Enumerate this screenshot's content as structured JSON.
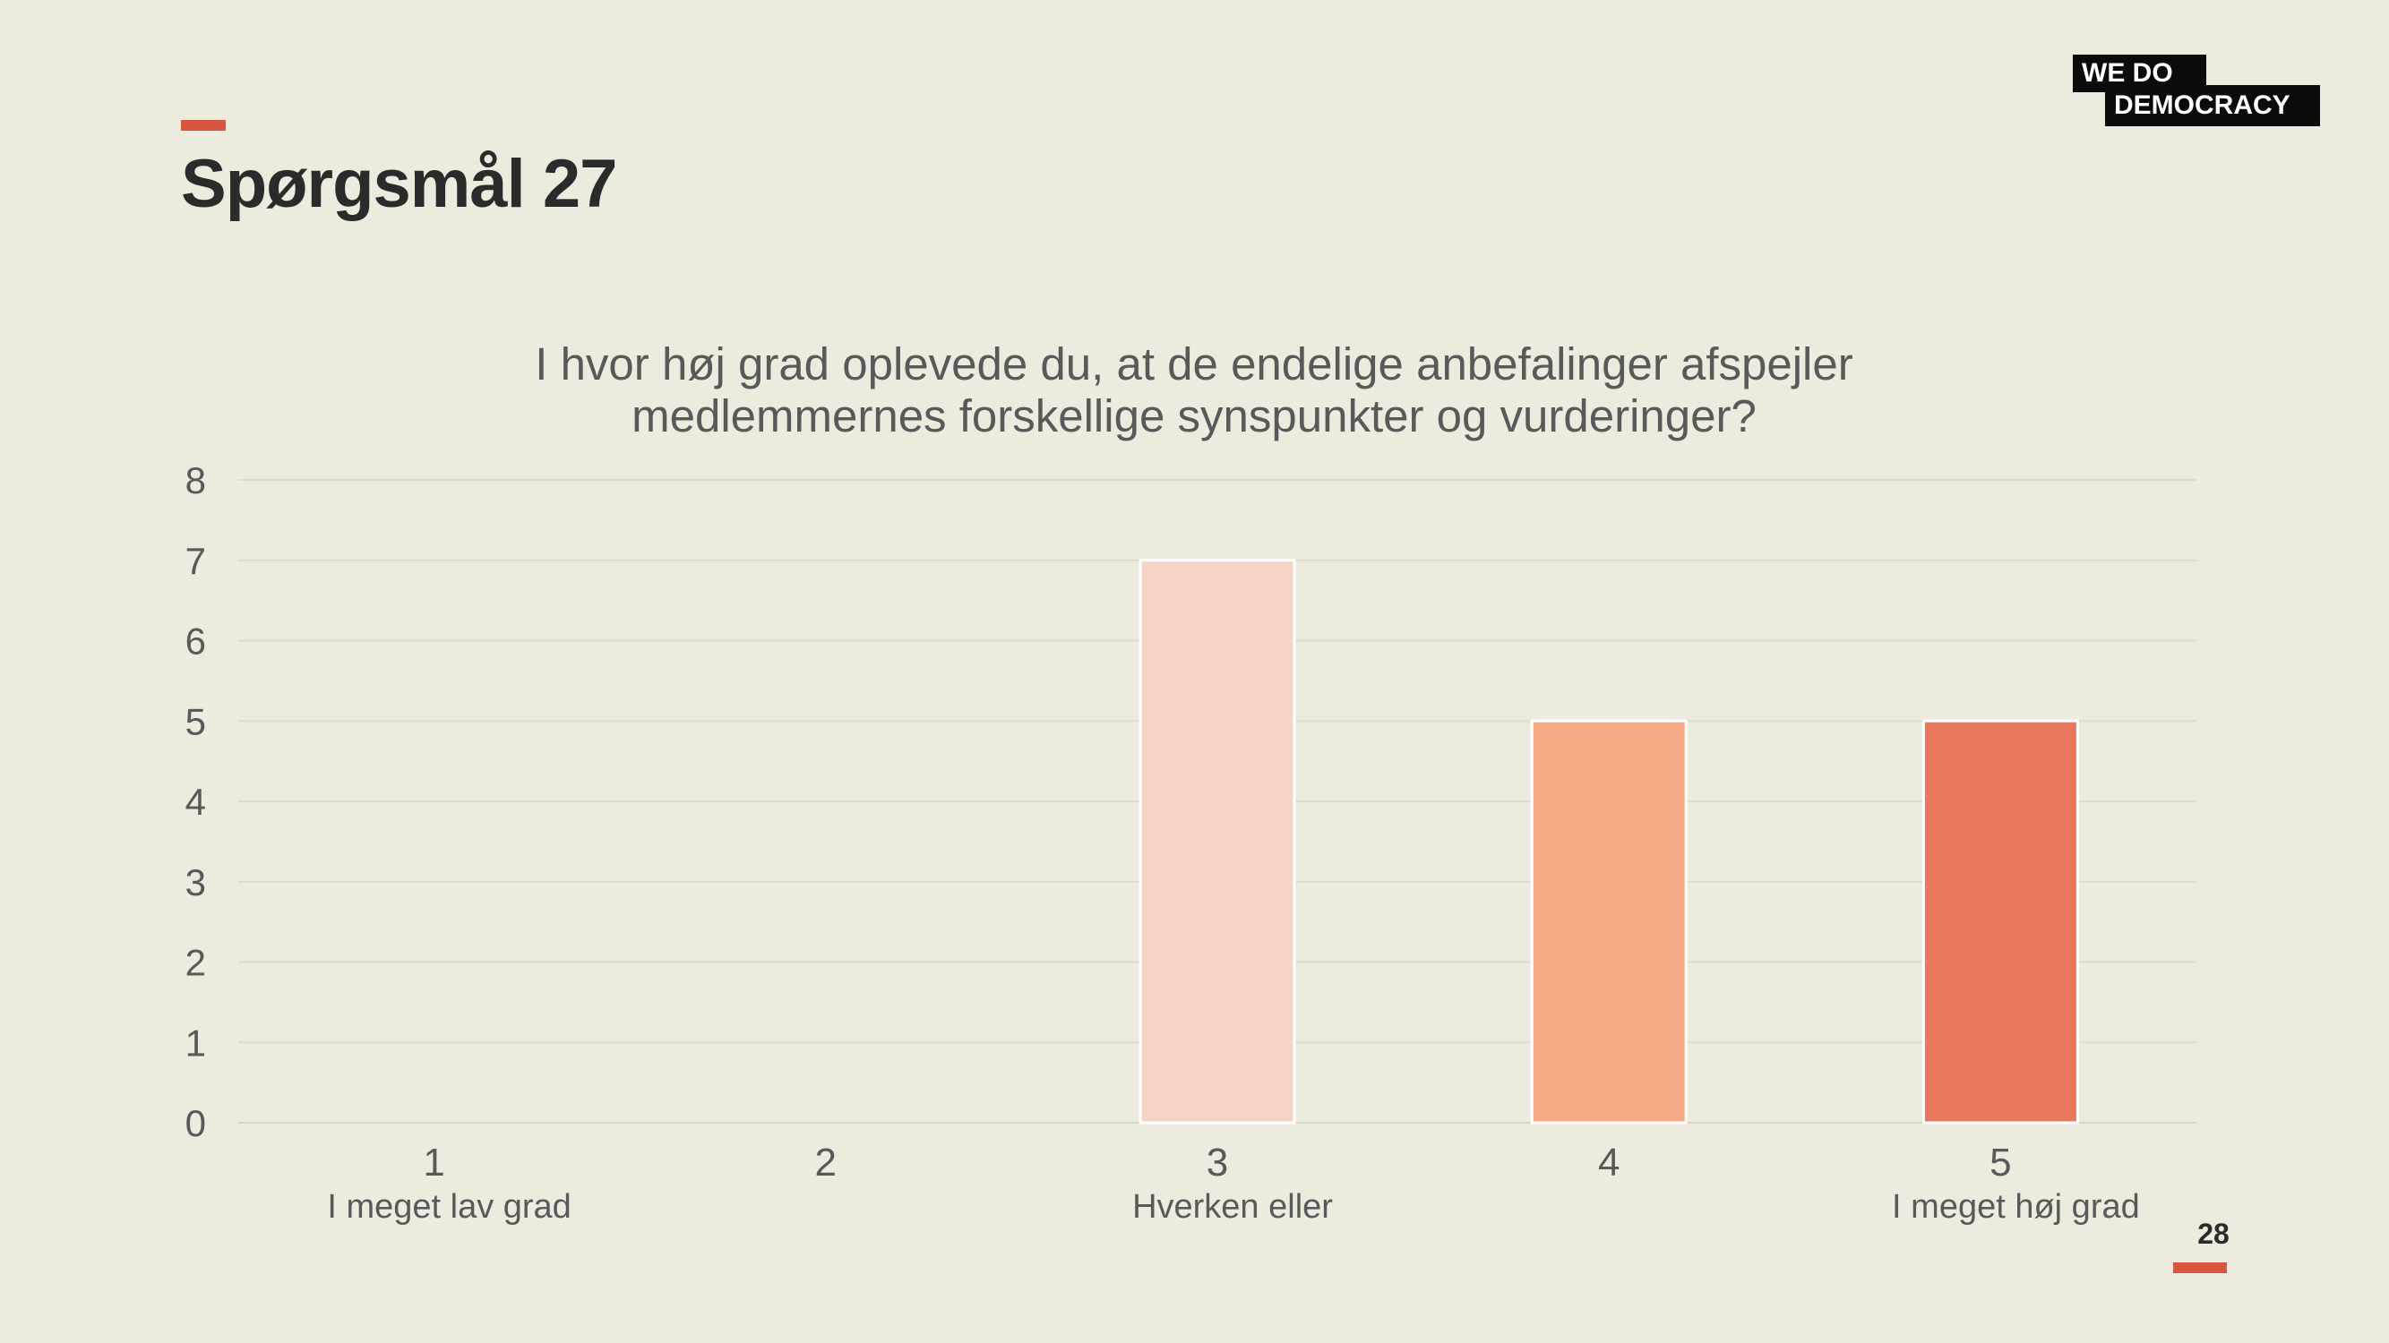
{
  "slide": {
    "title": "Spørgsmål 27",
    "page_number": "28",
    "accent_color": "#d9553f"
  },
  "logo": {
    "line1": "WE  DO",
    "line2": "DEMOCRACY"
  },
  "chart_data": {
    "type": "bar",
    "title_lines": [
      "I hvor høj grad oplevede du, at de endelige anbefalinger afspejler",
      "medlemmernes forskellige synspunkter og vurderinger?"
    ],
    "categories": [
      "1",
      "2",
      "3",
      "4",
      "5"
    ],
    "category_sublabels": [
      "I meget lav grad",
      "",
      "Hverken eller",
      "",
      "I meget høj grad"
    ],
    "values": [
      0,
      0,
      7,
      5,
      5
    ],
    "bar_colors": [
      "#f6d3c5",
      "#f6d3c5",
      "#f6d3c5",
      "#f6a985",
      "#e9775c"
    ],
    "ylim": [
      0,
      8
    ],
    "yticks": [
      0,
      1,
      2,
      3,
      4,
      5,
      6,
      7,
      8
    ],
    "grid": true,
    "xlabel": "",
    "ylabel": ""
  }
}
